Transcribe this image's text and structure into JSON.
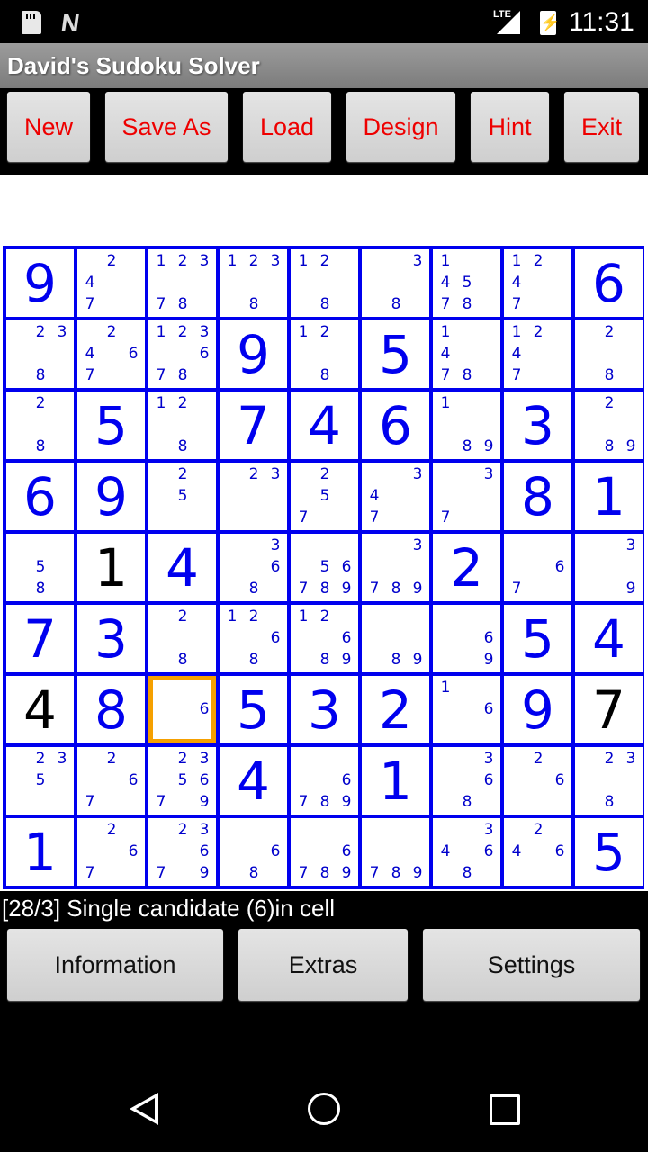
{
  "status_bar": {
    "time": "11:31",
    "network": "LTE",
    "icons": [
      "sd-card-icon",
      "n-notification-icon",
      "lte-signal-icon",
      "battery-charging-icon"
    ]
  },
  "app": {
    "title": "David's Sudoku Solver"
  },
  "toolbar": {
    "buttons": [
      {
        "label": "New"
      },
      {
        "label": "Save As"
      },
      {
        "label": "Load"
      },
      {
        "label": "Design"
      },
      {
        "label": "Hint"
      },
      {
        "label": "Exit"
      }
    ]
  },
  "colors": {
    "grid": "#0000ee",
    "solved_value": "#0000ee",
    "given_value": "#000000",
    "candidate": "#0000cc",
    "selection": "#f5a000",
    "toolbar_label": "#ee0000"
  },
  "board": {
    "selected": {
      "row": 7,
      "col": 3
    },
    "cells": [
      [
        {
          "v": "9"
        },
        {
          "c": [
            2,
            4,
            7
          ]
        },
        {
          "c": [
            1,
            2,
            3,
            7,
            8
          ]
        },
        {
          "c": [
            1,
            2,
            3,
            8
          ]
        },
        {
          "c": [
            1,
            2,
            8
          ]
        },
        {
          "c": [
            3,
            8
          ]
        },
        {
          "c": [
            1,
            4,
            5,
            7,
            8
          ]
        },
        {
          "c": [
            1,
            2,
            4,
            7
          ]
        },
        {
          "v": "6"
        }
      ],
      [
        {
          "c": [
            2,
            3,
            8
          ]
        },
        {
          "c": [
            2,
            4,
            6,
            7
          ]
        },
        {
          "c": [
            1,
            2,
            3,
            6,
            7,
            8
          ]
        },
        {
          "v": "9"
        },
        {
          "c": [
            1,
            2,
            8
          ]
        },
        {
          "v": "5"
        },
        {
          "c": [
            1,
            4,
            7,
            8
          ]
        },
        {
          "c": [
            1,
            2,
            4,
            7
          ]
        },
        {
          "c": [
            2,
            8
          ]
        }
      ],
      [
        {
          "c": [
            2,
            8
          ]
        },
        {
          "v": "5"
        },
        {
          "c": [
            1,
            2,
            8
          ]
        },
        {
          "v": "7"
        },
        {
          "v": "4"
        },
        {
          "v": "6"
        },
        {
          "c": [
            1,
            8,
            9
          ]
        },
        {
          "v": "3"
        },
        {
          "c": [
            2,
            8,
            9
          ]
        }
      ],
      [
        {
          "v": "6"
        },
        {
          "v": "9"
        },
        {
          "c": [
            2,
            5
          ]
        },
        {
          "c": [
            2,
            3
          ]
        },
        {
          "c": [
            2,
            5,
            7
          ]
        },
        {
          "c": [
            3,
            4,
            7
          ]
        },
        {
          "c": [
            3,
            7
          ]
        },
        {
          "v": "8"
        },
        {
          "v": "1"
        }
      ],
      [
        {
          "c": [
            5,
            8
          ]
        },
        {
          "v": "1",
          "g": true
        },
        {
          "v": "4"
        },
        {
          "c": [
            3,
            6,
            8
          ]
        },
        {
          "c": [
            5,
            6,
            7,
            8,
            9
          ]
        },
        {
          "c": [
            3,
            7,
            8,
            9
          ]
        },
        {
          "v": "2"
        },
        {
          "c": [
            6,
            7
          ]
        },
        {
          "c": [
            3,
            9
          ]
        }
      ],
      [
        {
          "v": "7"
        },
        {
          "v": "3"
        },
        {
          "c": [
            2,
            8
          ]
        },
        {
          "c": [
            1,
            2,
            6,
            8
          ]
        },
        {
          "c": [
            1,
            2,
            6,
            8,
            9
          ]
        },
        {
          "c": [
            8,
            9
          ]
        },
        {
          "c": [
            6,
            9
          ]
        },
        {
          "v": "5"
        },
        {
          "v": "4"
        }
      ],
      [
        {
          "v": "4",
          "g": true
        },
        {
          "v": "8"
        },
        {
          "c": [
            6
          ]
        },
        {
          "v": "5"
        },
        {
          "v": "3"
        },
        {
          "v": "2"
        },
        {
          "c": [
            1,
            6
          ]
        },
        {
          "v": "9"
        },
        {
          "v": "7",
          "g": true
        }
      ],
      [
        {
          "c": [
            2,
            3,
            5
          ]
        },
        {
          "c": [
            2,
            6,
            7
          ]
        },
        {
          "c": [
            2,
            3,
            5,
            6,
            7,
            9
          ]
        },
        {
          "v": "4"
        },
        {
          "c": [
            6,
            7,
            8,
            9
          ]
        },
        {
          "v": "1"
        },
        {
          "c": [
            3,
            6,
            8
          ]
        },
        {
          "c": [
            2,
            6
          ]
        },
        {
          "c": [
            2,
            3,
            8
          ]
        }
      ],
      [
        {
          "v": "1"
        },
        {
          "c": [
            2,
            6,
            7
          ]
        },
        {
          "c": [
            2,
            3,
            6,
            7,
            9
          ]
        },
        {
          "c": [
            6,
            8
          ]
        },
        {
          "c": [
            6,
            7,
            8,
            9
          ]
        },
        {
          "c": [
            7,
            8,
            9
          ]
        },
        {
          "c": [
            3,
            4,
            6,
            8
          ]
        },
        {
          "c": [
            2,
            4,
            6
          ]
        },
        {
          "v": "5"
        }
      ]
    ]
  },
  "message": "[28/3] Single candidate (6)in cell",
  "bottom_buttons": [
    {
      "label": "Information"
    },
    {
      "label": "Extras"
    },
    {
      "label": "Settings"
    }
  ],
  "nav": [
    "back-icon",
    "home-icon",
    "recents-icon"
  ]
}
